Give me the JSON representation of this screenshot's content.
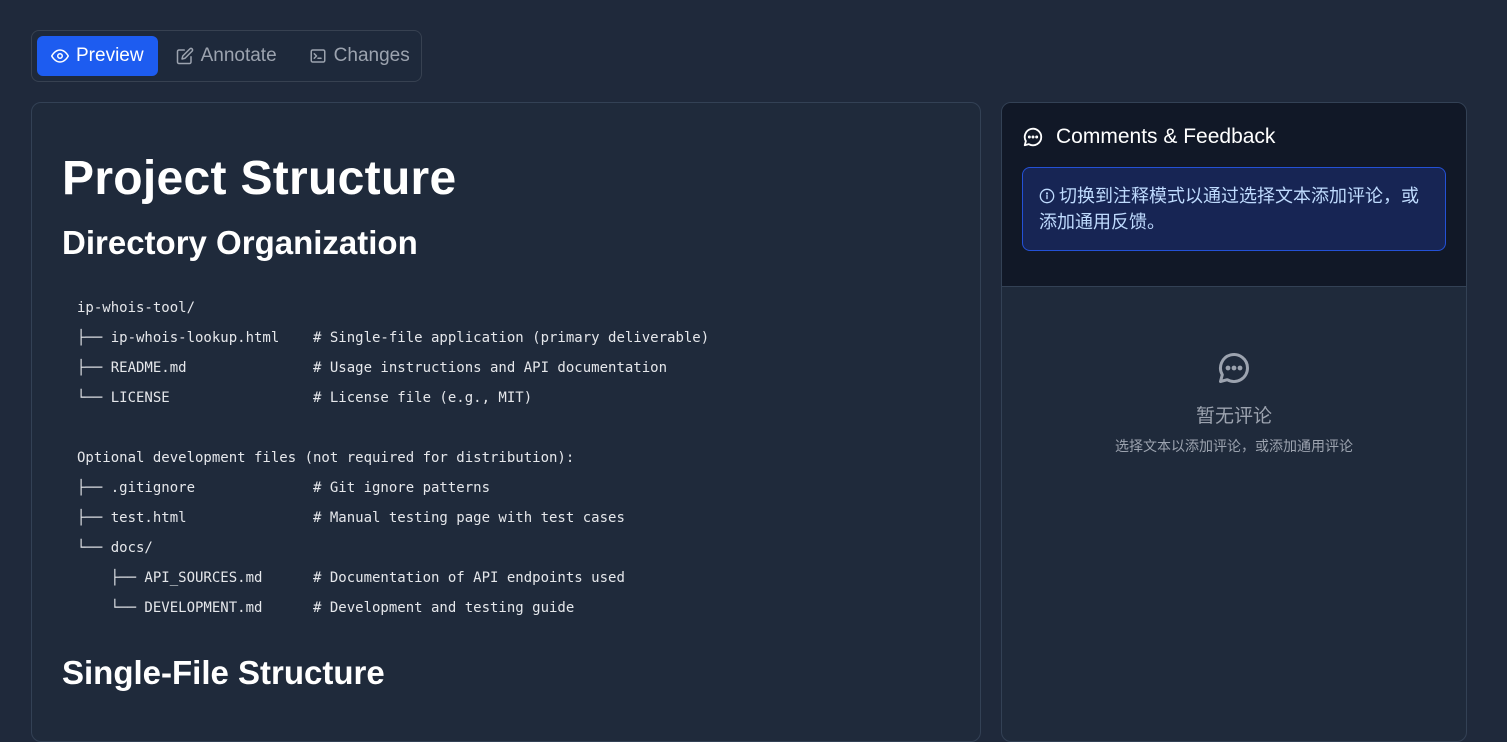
{
  "tabs": {
    "preview": "Preview",
    "annotate": "Annotate",
    "changes": "Changes",
    "active": "preview",
    "icons": {
      "preview": "eye-icon",
      "annotate": "pencil-square-icon",
      "changes": "terminal-icon"
    }
  },
  "document": {
    "title": "Project Structure",
    "heading1": "Directory Organization",
    "code_lines": [
      "ip-whois-tool/",
      "├── ip-whois-lookup.html    # Single-file application (primary deliverable)",
      "├── README.md               # Usage instructions and API documentation",
      "└── LICENSE                 # License file (e.g., MIT)",
      "",
      "Optional development files (not required for distribution):",
      "├── .gitignore              # Git ignore patterns",
      "├── test.html               # Manual testing page with test cases",
      "└── docs/",
      "    ├── API_SOURCES.md      # Documentation of API endpoints used",
      "    └── DEVELOPMENT.md      # Development and testing guide"
    ],
    "heading2": "Single-File Structure"
  },
  "comments": {
    "title": "Comments & Feedback",
    "title_icon": "chat-bubble-icon",
    "hint": "切换到注释模式以通过选择文本添加评论，或添加通用反馈。",
    "hint_icon": "info-icon",
    "empty_title": "暂无评论",
    "empty_subtitle": "选择文本以添加评论，或添加通用评论",
    "empty_icon": "chat-bubble-icon"
  },
  "colors": {
    "background": "#1f293b",
    "accent": "#1d5cf0",
    "panel_header": "#111827"
  }
}
